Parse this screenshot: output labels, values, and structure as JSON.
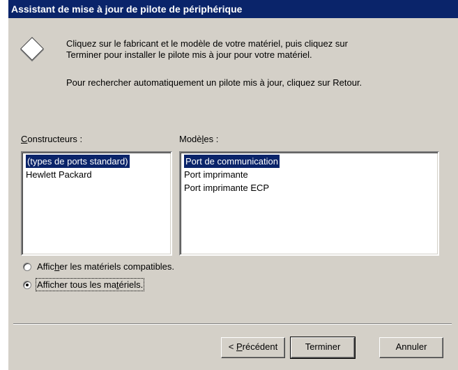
{
  "window": {
    "title": "Assistant de mise à jour de pilote de périphérique"
  },
  "intro": {
    "line1": "Cliquez sur le fabricant et le modèle de votre matériel, puis cliquez sur",
    "line2": "Terminer pour installer le pilote mis à jour pour votre matériel.",
    "line3": "Pour rechercher automatiquement un pilote mis à jour,  cliquez sur Retour."
  },
  "manufacturers": {
    "label_pre": "",
    "label_key": "C",
    "label_post": "onstructeurs :",
    "items": [
      "(types de ports standard)",
      "Hewlett Packard"
    ],
    "selected": "(types de ports standard)"
  },
  "models": {
    "label_pre": "Modè",
    "label_key": "l",
    "label_post": "es :",
    "items": [
      "Port de communication",
      "Port imprimante",
      "Port imprimante ECP"
    ],
    "selected": "Port de communication"
  },
  "options": {
    "compatible": {
      "pre": "Affic",
      "key": "h",
      "post": "er les matériels compatibles.",
      "checked": false
    },
    "all": {
      "pre": "Afficher tous les ma",
      "key": "t",
      "post": "ériels.",
      "checked": true
    }
  },
  "buttons": {
    "back": {
      "pre": "< ",
      "key": "P",
      "post": "récédent"
    },
    "finish": "Terminer",
    "cancel": "Annuler"
  }
}
